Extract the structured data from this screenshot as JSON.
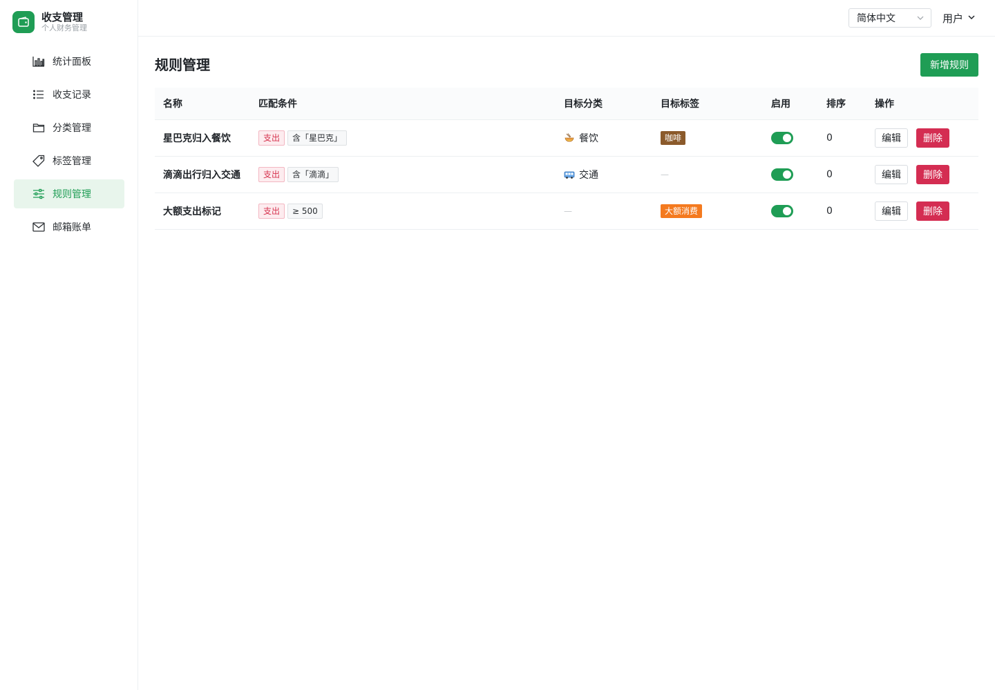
{
  "brand": {
    "title": "收支管理",
    "subtitle": "个人财务管理",
    "color": "#1f9d55"
  },
  "sidebar": {
    "items": [
      {
        "label": "统计面板",
        "icon": "bar-chart-icon",
        "active": false
      },
      {
        "label": "收支记录",
        "icon": "list-icon",
        "active": false
      },
      {
        "label": "分类管理",
        "icon": "folder-icon",
        "active": false
      },
      {
        "label": "标签管理",
        "icon": "tag-icon",
        "active": false
      },
      {
        "label": "规则管理",
        "icon": "sliders-icon",
        "active": true
      },
      {
        "label": "邮箱账单",
        "icon": "mail-icon",
        "active": false
      }
    ]
  },
  "topbar": {
    "language": "简体中文",
    "user": "用户"
  },
  "main": {
    "title": "规则管理",
    "add_button": "新增规则",
    "columns": [
      "名称",
      "匹配条件",
      "目标分类",
      "目标标签",
      "启用",
      "排序",
      "操作"
    ],
    "rows": [
      {
        "name": "星巴克归入餐饮",
        "type_chip": "支出",
        "condition": "含「星巴克」",
        "category": "餐饮",
        "category_icon": "noodle-bowl-icon",
        "tag": "咖啡",
        "tag_color": "#8b5a2b",
        "enabled": true,
        "order": "0",
        "edit": "编辑",
        "delete": "删除"
      },
      {
        "name": "滴滴出行归入交通",
        "type_chip": "支出",
        "condition": "含「滴滴」",
        "category": "交通",
        "category_icon": "bus-icon",
        "tag": "—",
        "tag_color": "",
        "enabled": true,
        "order": "0",
        "edit": "编辑",
        "delete": "删除"
      },
      {
        "name": "大额支出标记",
        "type_chip": "支出",
        "condition": "≥ 500",
        "category": "—",
        "category_icon": "",
        "tag": "大额消费",
        "tag_color": "#f47a1f",
        "enabled": true,
        "order": "0",
        "edit": "编辑",
        "delete": "删除"
      }
    ]
  },
  "colors": {
    "accent": "#1f9d55",
    "danger": "#d42d52",
    "active_bg": "#e8f5ec"
  }
}
